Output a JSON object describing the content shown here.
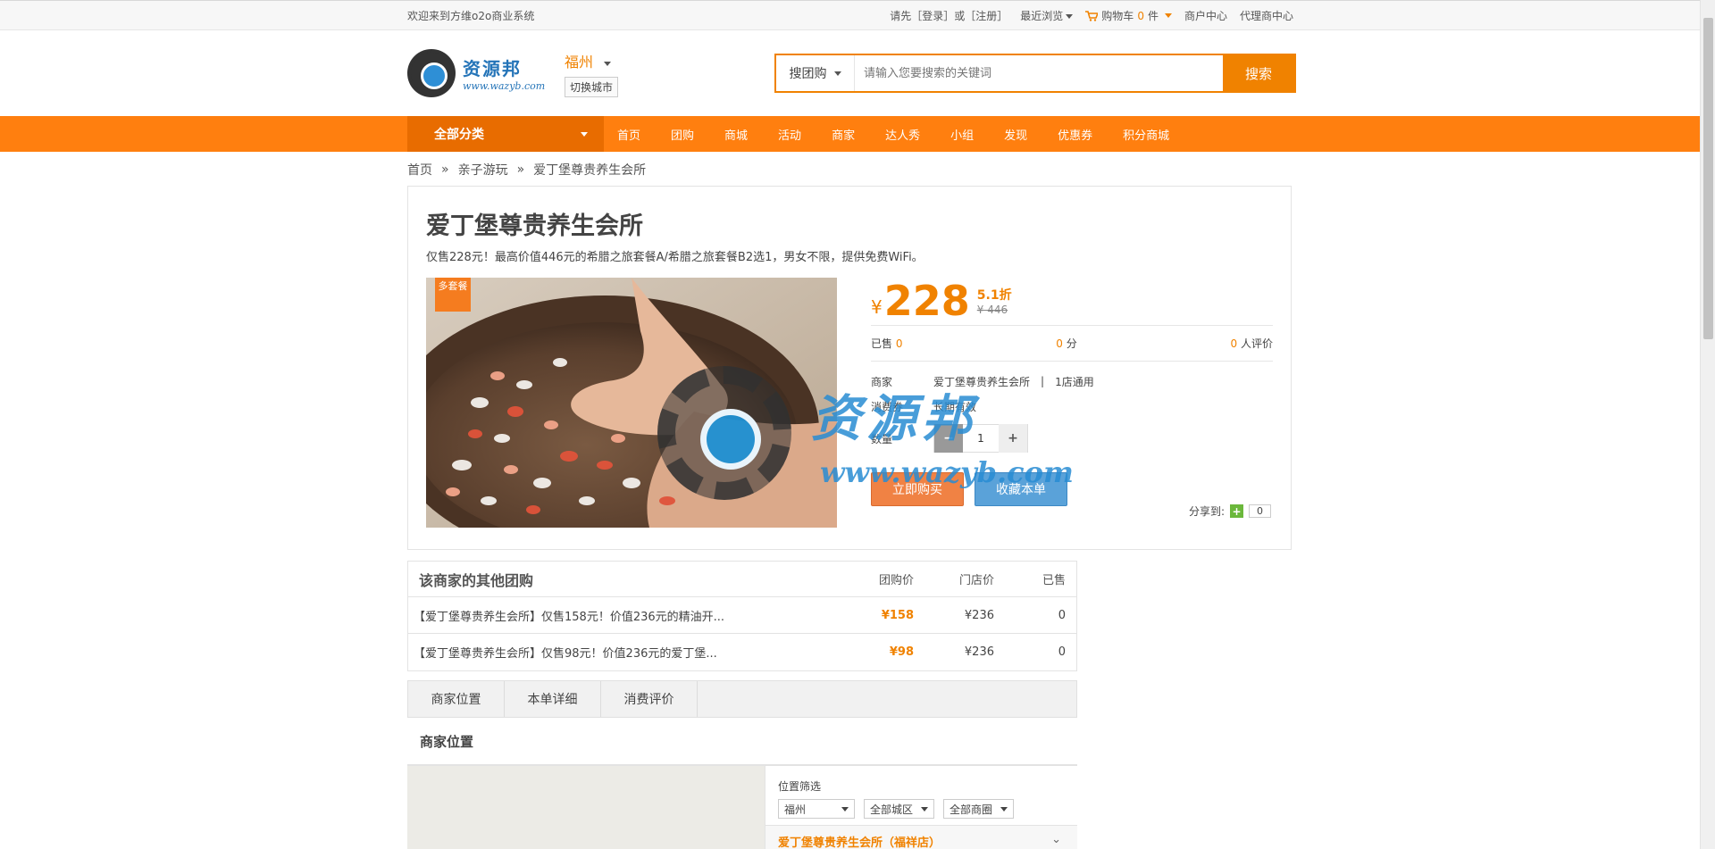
{
  "topbar": {
    "welcome": "欢迎来到方维o2o商业系统",
    "login_prompt": "请先［登录］或［注册］",
    "recent": "最近浏览",
    "cart_label": "购物车",
    "cart_count": "0",
    "cart_unit": "件",
    "merchant_center": "商户中心",
    "agent_center": "代理商中心"
  },
  "header": {
    "logo_cn": "资源邦",
    "logo_en": "www.wazyb.com",
    "city": "福州",
    "switch_city": "切换城市",
    "search_type": "搜团购",
    "search_placeholder": "请输入您要搜索的关键词",
    "search_button": "搜索"
  },
  "nav": {
    "all_categories": "全部分类",
    "items": [
      "首页",
      "团购",
      "商城",
      "活动",
      "商家",
      "达人秀",
      "小组",
      "发现",
      "优惠券",
      "积分商城"
    ]
  },
  "breadcrumb": [
    "首页",
    "亲子游玩",
    "爱丁堡尊贵养生会所"
  ],
  "deal": {
    "title": "爱丁堡尊贵养生会所",
    "subtitle": "仅售228元！最高价值446元的希腊之旅套餐A/希腊之旅套餐B2选1，男女不限，提供免费WiFi。",
    "badge": "多套餐",
    "currency": "¥",
    "price": "228",
    "discount": "5.1折",
    "original_price": "¥ 446",
    "sold_label": "已售",
    "sold": "0",
    "score": "0",
    "score_unit": "分",
    "reviews": "0",
    "reviews_unit": "人评价",
    "merchant_label": "商家",
    "merchant": "爱丁堡尊贵养生会所",
    "merchant_sep": "|",
    "stores": "1店通用",
    "voucher_label": "消费券",
    "voucher": "长期有效",
    "qty_label": "数量",
    "qty": "1",
    "buy_now": "立即购买",
    "favorite": "收藏本单",
    "share_label": "分享到:",
    "share_count": "0"
  },
  "watermark": {
    "cn": "资源邦",
    "en": "www.wazyb.com"
  },
  "others": {
    "title": "该商家的其他团购",
    "headers": [
      "团购价",
      "门店价",
      "已售"
    ],
    "rows": [
      {
        "title": "【爱丁堡尊贵养生会所】仅售158元！价值236元的精油开...",
        "price": "¥158",
        "store_price": "¥236",
        "sold": "0"
      },
      {
        "title": "【爱丁堡尊贵养生会所】仅售98元！价值236元的爱丁堡...",
        "price": "¥98",
        "store_price": "¥236",
        "sold": "0"
      }
    ]
  },
  "tabs": [
    "商家位置",
    "本单详细",
    "消费评价"
  ],
  "location": {
    "title": "商家位置",
    "filter_label": "位置筛选",
    "city_select": "福州",
    "district_select": "全部城区",
    "area_select": "全部商圈",
    "shop_name": "爱丁堡尊贵养生会所（福祥店）"
  },
  "colors": {
    "accent": "#f08200",
    "nav_bg": "#ff7f0f",
    "fav_button": "#5aa2d9"
  }
}
